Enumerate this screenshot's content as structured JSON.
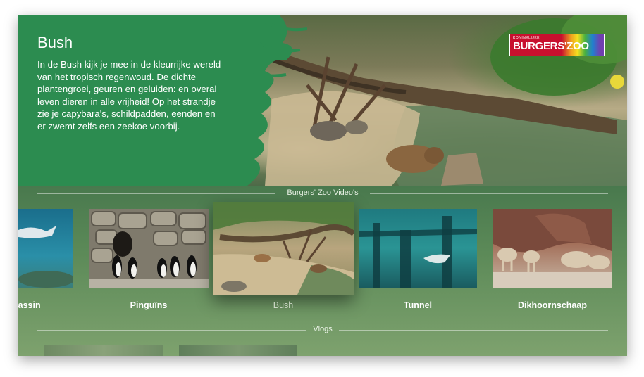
{
  "hero": {
    "title": "Bush",
    "description": "In de Bush kijk je mee in de kleurrijke wereld van het tropisch regenwoud. De dichte plantengroei, geuren en geluiden: en overal leven dieren in alle vrijheid! Op het strandje zie je capybara's, schildpadden, eenden en er zwemt zelfs een zeekoe voorbij.",
    "logo": {
      "small_text": "KONINKLIJKE",
      "main_text": "BURGERS'ZOO"
    }
  },
  "sections": [
    {
      "title": "Burgers' Zoo Video's",
      "items": [
        {
          "label": "bassin",
          "icon": "shark-thumbnail"
        },
        {
          "label": "Pinguïns",
          "icon": "penguins-thumbnail"
        },
        {
          "label": "Bush",
          "icon": "bush-thumbnail",
          "focused": true
        },
        {
          "label": "Tunnel",
          "icon": "tunnel-thumbnail"
        },
        {
          "label": "Dikhoornschaap",
          "icon": "bighorn-sheep-thumbnail"
        }
      ]
    },
    {
      "title": "Vlogs"
    }
  ],
  "colors": {
    "panel_green": "#2c8c50",
    "focus_label": "#cfd9c8"
  }
}
